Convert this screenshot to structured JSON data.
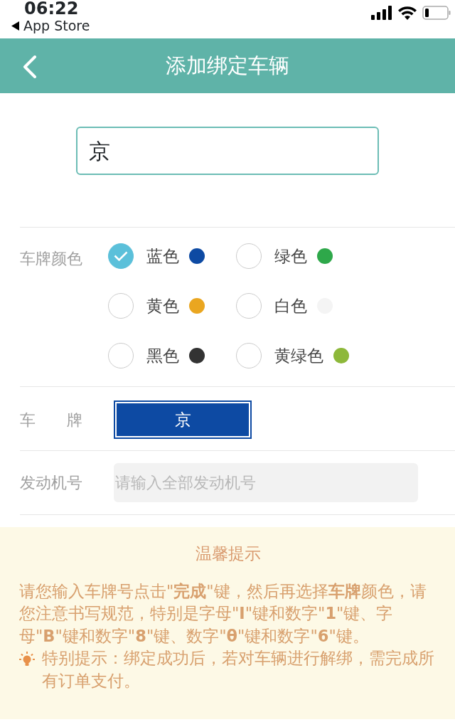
{
  "status_bar": {
    "time": "06:22",
    "back_app": "App Store"
  },
  "header": {
    "title": "添加绑定车辆"
  },
  "plate_input": {
    "value": "京"
  },
  "plate_color": {
    "label": "车牌颜色",
    "options": [
      {
        "label": "蓝色",
        "selected": true,
        "color": "#0d4aa3"
      },
      {
        "label": "绿色",
        "selected": false,
        "color": "#2ea84a"
      },
      {
        "label": "黄色",
        "selected": false,
        "color": "#eaa620"
      },
      {
        "label": "白色",
        "selected": false,
        "color": "#f4f4f4"
      },
      {
        "label": "黑色",
        "selected": false,
        "color": "#333333"
      },
      {
        "label": "黄绿色",
        "selected": false,
        "color": "#8db83a"
      }
    ]
  },
  "plate": {
    "label": "车　　牌",
    "value": "京"
  },
  "engine": {
    "label": "发动机号",
    "placeholder": "请输入全部发动机号"
  },
  "tips": {
    "title": "温馨提示",
    "text": "请您输入车牌号点击\"**完成**\"键，然后再选择**车牌**颜色，请您注意书写规范，特别是字母\"**I**\"键和数字\"**1**\"键、字母\"**B**\"键和数字\"**8**\"键、数字\"**θ**\"键和数字\"**6**\"键。",
    "notice": "特别提示：绑定成功后，若对车辆进行解绑，需完成所有订单支付。"
  }
}
